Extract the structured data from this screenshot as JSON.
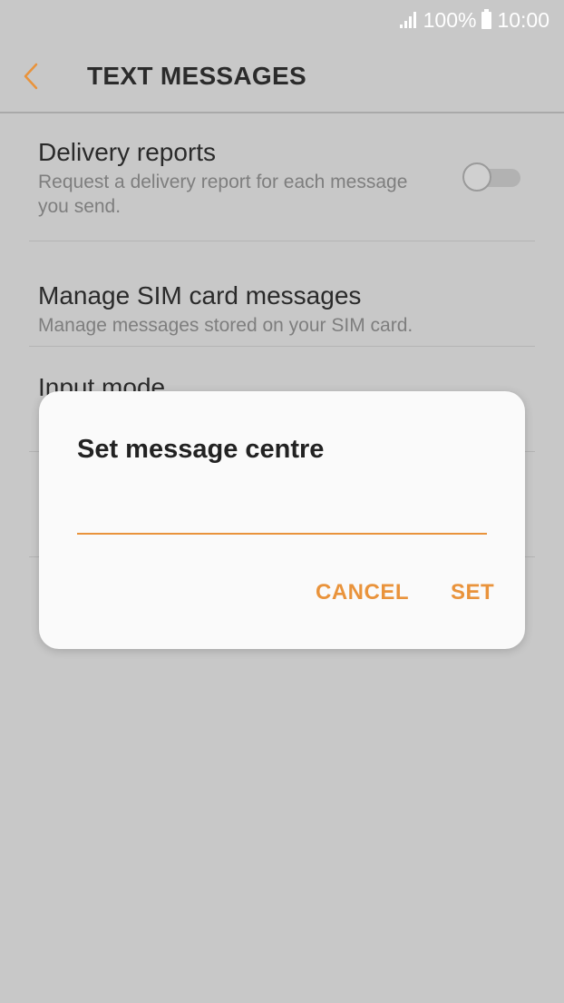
{
  "status_bar": {
    "battery": "100%",
    "time": "10:00"
  },
  "header": {
    "title": "TEXT MESSAGES",
    "accent_color": "#e9933b"
  },
  "settings": [
    {
      "title": "Delivery reports",
      "subtitle": "Request a delivery report for each message you send.",
      "toggle_on": false
    },
    {
      "title": "Manage SIM card messages",
      "subtitle": "Manage messages stored on your SIM card."
    },
    {
      "title": "Input mode"
    }
  ],
  "dialog": {
    "title": "Set message centre",
    "input_value": "",
    "cancel_label": "CANCEL",
    "set_label": "SET"
  }
}
